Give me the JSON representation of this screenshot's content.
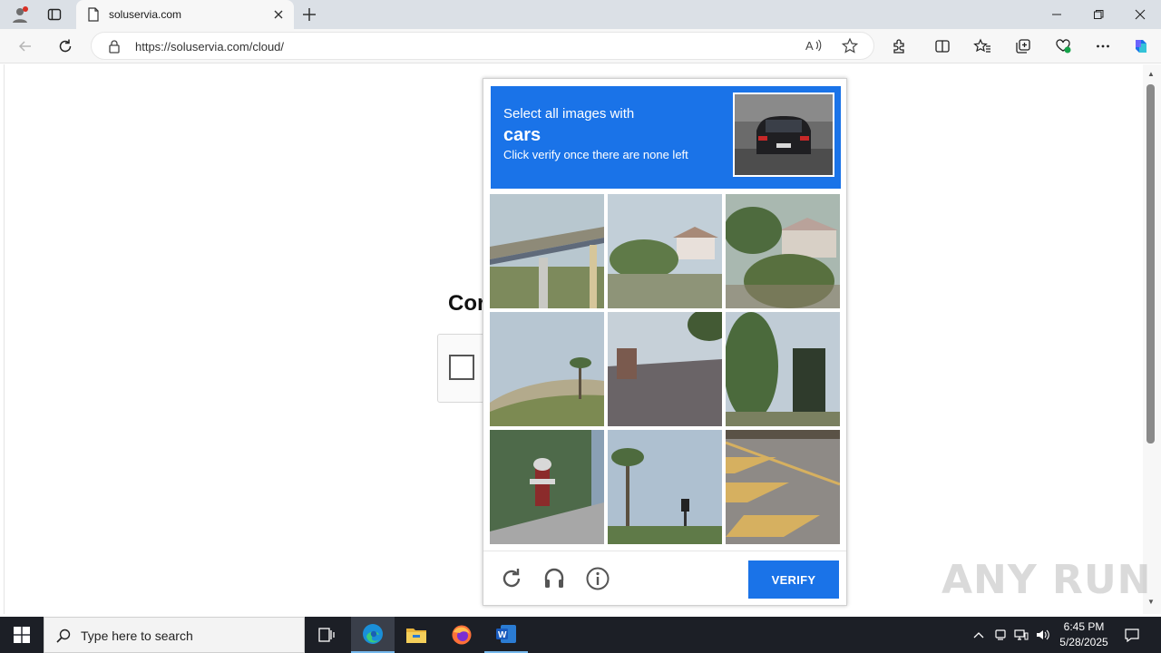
{
  "browser": {
    "tab_title": "soluservia.com",
    "url": "https://soluservia.com/cloud/"
  },
  "page": {
    "heading_partial": "Cor"
  },
  "captcha": {
    "instruction_line1": "Select all images with",
    "target": "cars",
    "instruction_line3": "Click verify once there are none left",
    "verify_label": "VERIFY"
  },
  "watermark": "ANY RUN",
  "taskbar": {
    "search_placeholder": "Type here to search",
    "time": "6:45 PM",
    "date": "5/28/2025"
  },
  "colors": {
    "accent": "#1a73e8",
    "taskbar": "#1c1f26"
  }
}
